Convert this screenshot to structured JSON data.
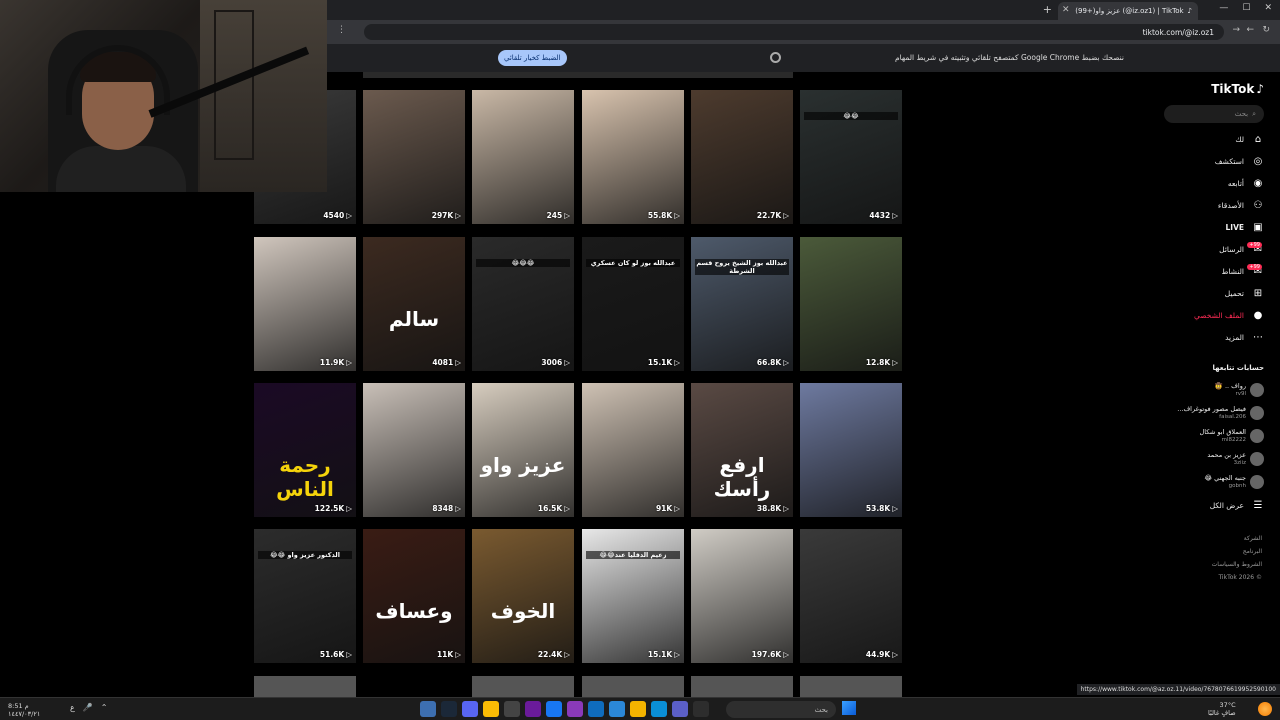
{
  "browser": {
    "tab_title": "(99+)عزيز واو (@iz.oz1) | TikTok",
    "address": "tiktok.com/@iz.oz1",
    "infobar_text": "ننصحك بضبط Google Chrome كمتصفح تلقائي وتثبيته في شريط المهام",
    "infobar_button": "الضبط كخيار تلقائي",
    "status_url": "https://www.tiktok.com/@az.oz.11/video/7678076619952590100"
  },
  "sidebar": {
    "logo": "TikTok",
    "search_placeholder": "بحث",
    "nav": [
      {
        "label": "لك",
        "icon": "home-icon"
      },
      {
        "label": "استكشف",
        "icon": "compass-icon"
      },
      {
        "label": "أتابعه",
        "icon": "following-icon"
      },
      {
        "label": "الأصدقاء",
        "icon": "friends-icon"
      },
      {
        "label": "LIVE",
        "icon": "live-icon"
      },
      {
        "label": "الرسائل",
        "icon": "messages-icon",
        "badge": "99+"
      },
      {
        "label": "النشاط",
        "icon": "activity-icon",
        "badge": "99+"
      },
      {
        "label": "تحميل",
        "icon": "upload-icon"
      },
      {
        "label": "الملف الشخصي",
        "icon": "profile-icon"
      },
      {
        "label": "المزيد",
        "icon": "more-icon"
      }
    ],
    "following_title": "حسابات تتابعها",
    "accounts": [
      {
        "name": "رواف .. 🤠",
        "handle": "rv9l"
      },
      {
        "name": "فيصل مصور فوتوغراف...",
        "handle": "faisal.206"
      },
      {
        "name": "العملاق ابو شكال",
        "handle": "ml82222"
      },
      {
        "name": "عزيز بن محمد",
        "handle": "3ziiz"
      },
      {
        "name": "جنبه الجهني 😂",
        "handle": "gobnh"
      }
    ],
    "show_all": "عرض الكل",
    "footer": [
      "الشركة",
      "البرنامج",
      "الشروط والسياسات",
      "© 2026 TikTok"
    ]
  },
  "grid": {
    "rows": [
      [
        {
          "views": "4540",
          "caption": ""
        },
        {
          "views": "297K",
          "caption": ""
        },
        {
          "views": "245",
          "caption": ""
        },
        {
          "views": "55.8K",
          "caption": ""
        },
        {
          "views": "22.7K",
          "caption": ""
        },
        {
          "views": "4432",
          "caption": "😂😂"
        }
      ],
      [
        {
          "views": "11.9K",
          "caption": ""
        },
        {
          "views": "4081",
          "caption": "سالم"
        },
        {
          "views": "3006",
          "caption": "😂😂😂"
        },
        {
          "views": "15.1K",
          "caption": "عبدالله بوز لو كان عسكري"
        },
        {
          "views": "66.8K",
          "caption": "عبدالله بوز الشيخ يروح قسم الشرطة"
        },
        {
          "views": "12.8K",
          "caption": ""
        }
      ],
      [
        {
          "views": "122.5K",
          "caption": "رحمة الناس"
        },
        {
          "views": "8348",
          "caption": ""
        },
        {
          "views": "16.5K",
          "caption": "عزيز واو"
        },
        {
          "views": "91K",
          "caption": ""
        },
        {
          "views": "38.8K",
          "caption": "ارفع رأسك"
        },
        {
          "views": "53.8K",
          "caption": ""
        }
      ],
      [
        {
          "views": "51.6K",
          "caption": "الدكتور عزيز واو 😂😂"
        },
        {
          "views": "11K",
          "caption": "وعساف"
        },
        {
          "views": "22.4K",
          "caption": "الخوف"
        },
        {
          "views": "15.1K",
          "caption": "زعيم الدقليا عند😂😂"
        },
        {
          "views": "197.6K",
          "caption": ""
        },
        {
          "views": "44.9K",
          "caption": ""
        }
      ]
    ]
  },
  "taskbar": {
    "search": "بحث",
    "weather_temp": "37°C",
    "weather_desc": "صافٍ غالبًا",
    "clock": "8:51 م",
    "date": "١٤٤٧/٠٣/٢١",
    "lang": "ع"
  }
}
